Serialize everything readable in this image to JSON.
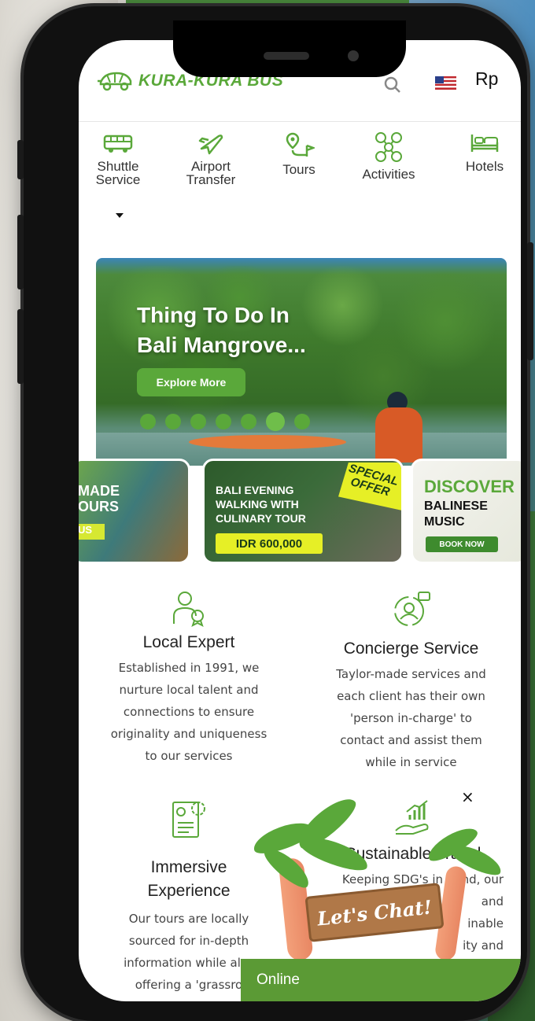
{
  "header": {
    "brand": "KURA-KURA BUS",
    "currency": "Rp",
    "icons": [
      "turtle-bus-logo-icon",
      "search-icon",
      "us-flag-icon"
    ]
  },
  "nav": {
    "items": [
      {
        "label": "Shuttle Service",
        "icon": "bus-icon"
      },
      {
        "label": "Airport Transfer",
        "icon": "plane-icon"
      },
      {
        "label": "Tours",
        "icon": "route-pin-icon"
      },
      {
        "label": "Activities",
        "icon": "activities-icon"
      },
      {
        "label": "Hotels",
        "icon": "bed-icon"
      }
    ]
  },
  "hero": {
    "title_line1": "Thing To Do In",
    "title_line2": "Bali Mangrove...",
    "button": "Explore More",
    "slides": 7,
    "active_slide": 6
  },
  "promos": {
    "card1": {
      "line1": "MADE",
      "line2": "OURS",
      "tag": "US"
    },
    "card2": {
      "line1": "BALI EVENING",
      "line2": "WALKING WITH",
      "line3": "CULINARY TOUR",
      "price": "IDR 600,000",
      "badge1": "SPECIAL",
      "badge2": "OFFER"
    },
    "card3": {
      "line1": "DISCOVER",
      "line2": "BALINESE",
      "line3": "MUSIC",
      "button": "BOOK NOW"
    }
  },
  "features": [
    {
      "title": "Local Expert",
      "text": [
        "Established in 1991, we",
        "nurture local talent and",
        "connections to ensure",
        "originality and uniqueness",
        "to our services"
      ],
      "icon": "local-expert-icon"
    },
    {
      "title": "Concierge Service",
      "text": [
        "Taylor-made services and",
        "each client has their own",
        "'person in-charge' to",
        "contact and assist them",
        "while in service"
      ],
      "icon": "concierge-icon"
    },
    {
      "title_line1": "Immersive",
      "title_line2": "Experience",
      "text": [
        "Our tours are locally",
        "sourced for in-depth",
        "information while also",
        "offering a 'grassro"
      ],
      "icon": "immersive-doc-icon"
    },
    {
      "title": "Sustainable Travel",
      "text": [
        "Keeping SDG's in mind, our",
        "and",
        "inable",
        "ity and"
      ],
      "icon": "growth-hand-icon"
    }
  ],
  "chat": {
    "close": "×",
    "sign": "Let's Chat!",
    "status": "Online"
  },
  "colors": {
    "brand_green": "#5aa83a",
    "offer_yellow": "#e6ef26",
    "online_green": "#5b9a35"
  }
}
